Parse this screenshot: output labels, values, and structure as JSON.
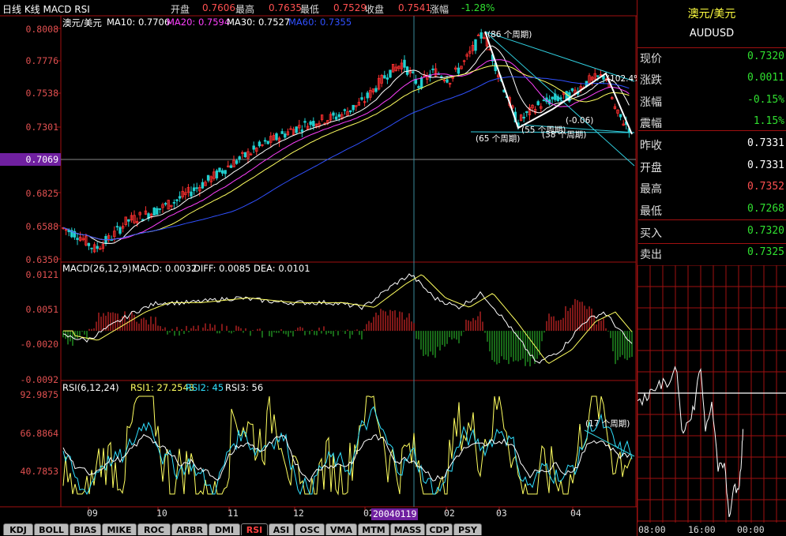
{
  "top": {
    "title": "日线 K线 MACD RSI",
    "open_label": "开盘",
    "open_value": "0.7606",
    "high_label": "最高",
    "high_value": "0.7635",
    "low_label": "最低",
    "low_value": "0.7529",
    "close_label": "收盘",
    "close_value": "0.7541",
    "change_label": "涨幅",
    "change_value": "-1.28%"
  },
  "main": {
    "legend_name": "澳元/美元",
    "ma10": "MA10: 0.7706",
    "ma20": "MA20: 0.7594",
    "ma30": "MA30: 0.7527",
    "ma60": "MA60: 0.7355",
    "yticks": [
      "0.8008",
      "0.7776",
      "0.7538",
      "0.7301",
      "0.7069",
      "0.6825",
      "0.6588",
      "0.6350"
    ],
    "cursor_price": "0.7069",
    "annotations": [
      "(86 个周期)",
      "(65 个周期)",
      "(55 个周期)",
      "(38 个周期)",
      "(-0.06)",
      "(102.4%)"
    ]
  },
  "macd": {
    "legend_name": "MACD(26,12,9)",
    "macd": "MACD: 0.0032",
    "diff": "DIFF: 0.0085",
    "dea": "DEA: 0.0101",
    "yticks": [
      "0.0121",
      "0.0051",
      "-0.0020",
      "-0.0092"
    ]
  },
  "rsi": {
    "legend_name": "RSI(6,12,24)",
    "rsi1": "RSI1: 27.2543",
    "rsi2": "RSI2: 45",
    "rsi3": "RSI3: 56",
    "yticks": [
      "92.9875",
      "66.8864",
      "40.7853"
    ],
    "annotation": "(17 个周期)"
  },
  "xaxis": {
    "months": [
      "09",
      "10",
      "11",
      "12",
      "02",
      "03",
      "04"
    ],
    "cursor_date": "20040119"
  },
  "tabs": [
    "KDJ",
    "BOLL",
    "BIAS",
    "MIKE",
    "ROC",
    "ARBR",
    "DMI",
    "RSI",
    "ASI",
    "OSC",
    "VMA",
    "MTM",
    "MASS",
    "CDP",
    "PSY"
  ],
  "active_tab": "RSI",
  "quote": {
    "name": "澳元/美元",
    "symbol": "AUDUSD",
    "rows": [
      {
        "label": "现价",
        "value": "0.7320",
        "color": "#30e030"
      },
      {
        "label": "涨跌",
        "value": "0.0011",
        "color": "#30e030"
      },
      {
        "label": "涨幅",
        "value": "-0.15%",
        "color": "#30e030"
      },
      {
        "label": "震幅",
        "value": "1.15%",
        "color": "#30e030"
      },
      {
        "label": "昨收",
        "value": "0.7331",
        "color": "#ffffff"
      },
      {
        "label": "开盘",
        "value": "0.7331",
        "color": "#ffffff"
      },
      {
        "label": "最高",
        "value": "0.7352",
        "color": "#ff5050"
      },
      {
        "label": "最低",
        "value": "0.7268",
        "color": "#30e030"
      },
      {
        "label": "买入",
        "value": "0.7320",
        "color": "#30e030"
      },
      {
        "label": "卖出",
        "value": "0.7325",
        "color": "#30e030"
      }
    ],
    "times": [
      "08:00",
      "16:00",
      "00:00"
    ]
  },
  "colors": {
    "up": "#ff3030",
    "down": "#20d0d0",
    "ma10": "#ffffff",
    "ma20": "#ff40ff",
    "ma30": "#ffff60",
    "ma60": "#3050ff",
    "grid": "#a01010",
    "label": "#e05050"
  }
}
